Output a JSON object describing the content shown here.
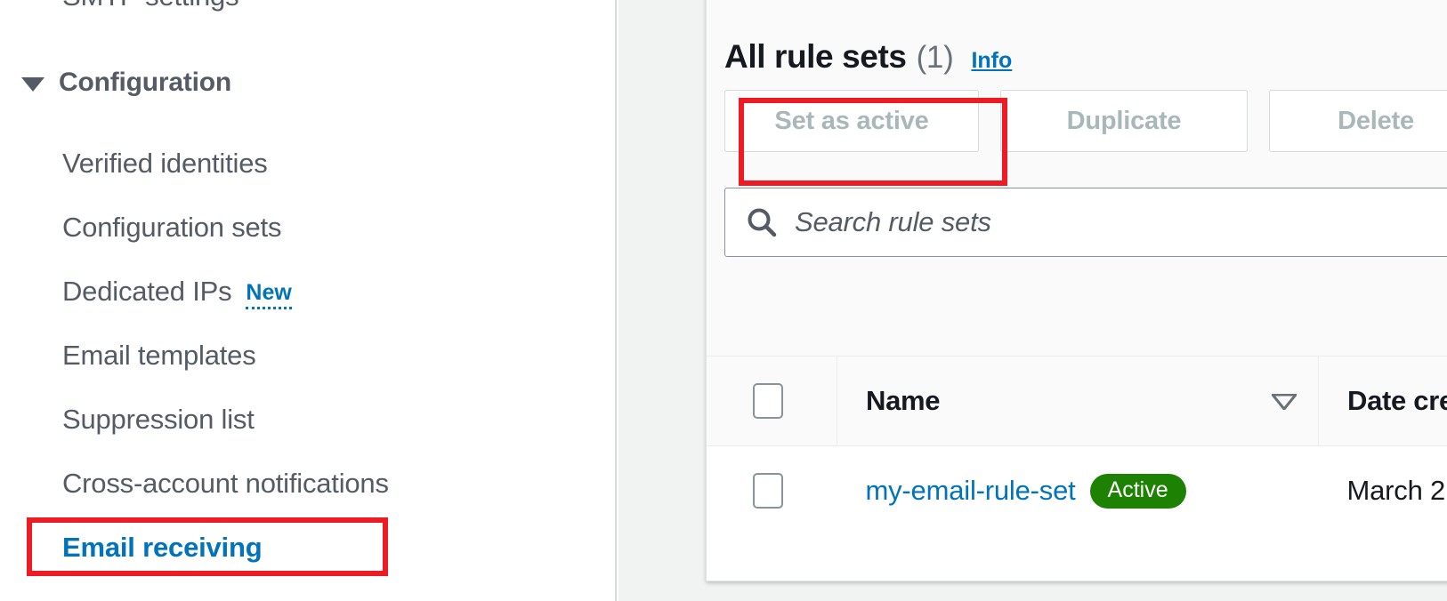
{
  "sidebar": {
    "partial_item_above": "SMTP settings",
    "group": {
      "label": "Configuration",
      "caret_icon": "caret-down-icon"
    },
    "items": [
      {
        "label": "Verified identities",
        "badge": "",
        "active": false
      },
      {
        "label": "Configuration sets",
        "badge": "",
        "active": false
      },
      {
        "label": "Dedicated IPs",
        "badge": "New",
        "active": false
      },
      {
        "label": "Email templates",
        "badge": "",
        "active": false
      },
      {
        "label": "Suppression list",
        "badge": "",
        "active": false
      },
      {
        "label": "Cross-account notifications",
        "badge": "",
        "active": false
      },
      {
        "label": "Email receiving",
        "badge": "",
        "active": true
      }
    ]
  },
  "main": {
    "title": "All rule sets",
    "count": "(1)",
    "info_link": "Info",
    "buttons": [
      {
        "label": "Set as active",
        "disabled": true,
        "highlighted": true
      },
      {
        "label": "Duplicate",
        "disabled": true,
        "highlighted": false
      },
      {
        "label": "Delete",
        "disabled": true,
        "highlighted": false
      }
    ],
    "search": {
      "placeholder": "Search rule sets",
      "value": "",
      "icon": "search-icon"
    },
    "table": {
      "columns": [
        {
          "label": "",
          "type": "checkbox"
        },
        {
          "label": "Name",
          "sort_icon": "sort-descending-icon"
        },
        {
          "label": "Date cre",
          "sort_icon": ""
        }
      ],
      "rows": [
        {
          "selected": false,
          "name": "my-email-rule-set",
          "status_badge": "Active",
          "date_created": "March 2"
        }
      ]
    }
  },
  "colors": {
    "link_blue": "#0073bb",
    "text_gray": "#545b64",
    "text_dark": "#16191f",
    "disabled_gray": "#aab7b8",
    "badge_green": "#1d8102",
    "highlight_red": "#ed1c24",
    "backdrop_gray": "#f1f3f3",
    "card_head_gray": "#fafafa"
  }
}
